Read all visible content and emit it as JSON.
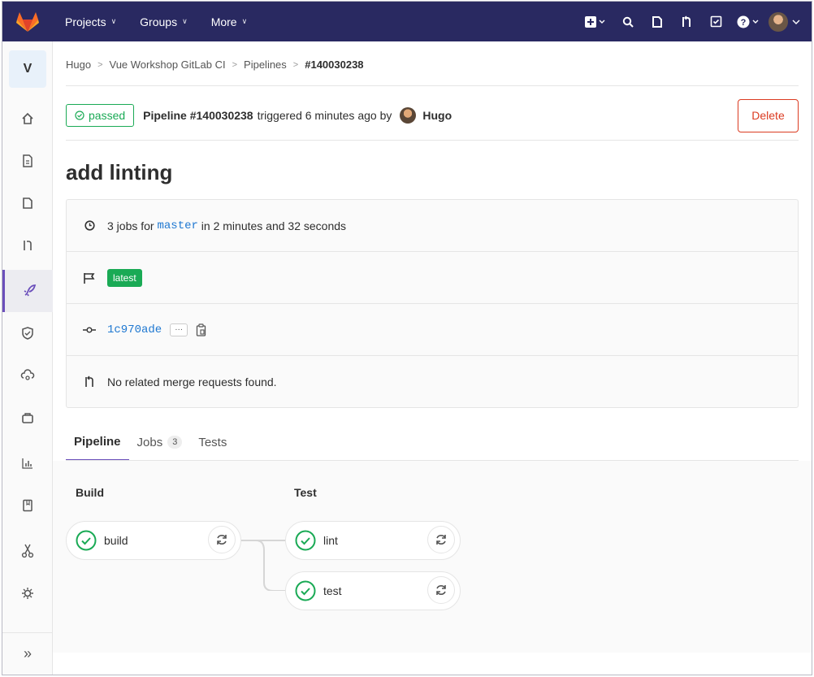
{
  "navbar": {
    "menu": [
      {
        "label": "Projects"
      },
      {
        "label": "Groups"
      },
      {
        "label": "More"
      }
    ],
    "icons": [
      "plus-square-icon",
      "search-icon",
      "issues-icon",
      "merge-request-icon",
      "todo-icon",
      "help-icon",
      "user-avatar"
    ]
  },
  "sidebar": {
    "project_letter": "V",
    "items": [
      "home-icon",
      "repository-icon",
      "issues-icon",
      "merge-requests-icon",
      "ci-cd-icon",
      "security-icon",
      "operations-icon",
      "packages-icon",
      "analytics-icon",
      "wiki-icon",
      "snippets-icon",
      "settings-icon"
    ],
    "active_item": "ci-cd-icon",
    "collapse_label": "»"
  },
  "breadcrumb": [
    "Hugo",
    "Vue Workshop GitLab CI",
    "Pipelines",
    "#140030238"
  ],
  "pipeline_header": {
    "status": "passed",
    "pipeline_label": "Pipeline #140030238",
    "triggered_text": "triggered 6 minutes ago by",
    "user": "Hugo",
    "delete_label": "Delete"
  },
  "title": "add linting",
  "info": {
    "jobs_prefix": "3 jobs for",
    "branch": "master",
    "duration_text": "in 2 minutes and 32 seconds",
    "tag": "latest",
    "commit_sha": "1c970ade",
    "ellipsis": "···",
    "merge_requests_text": "No related merge requests found."
  },
  "tabs": [
    {
      "label": "Pipeline",
      "active": true
    },
    {
      "label": "Jobs",
      "count": "3"
    },
    {
      "label": "Tests"
    }
  ],
  "stages": [
    {
      "name": "Build",
      "jobs": [
        {
          "name": "build",
          "status": "success"
        }
      ]
    },
    {
      "name": "Test",
      "jobs": [
        {
          "name": "lint",
          "status": "success"
        },
        {
          "name": "test",
          "status": "success"
        }
      ]
    }
  ],
  "colors": {
    "navbar": "#292961",
    "success": "#1aaa55",
    "danger": "#db3b21",
    "link": "#1f78d1",
    "active_tab": "#6b4fbb"
  }
}
